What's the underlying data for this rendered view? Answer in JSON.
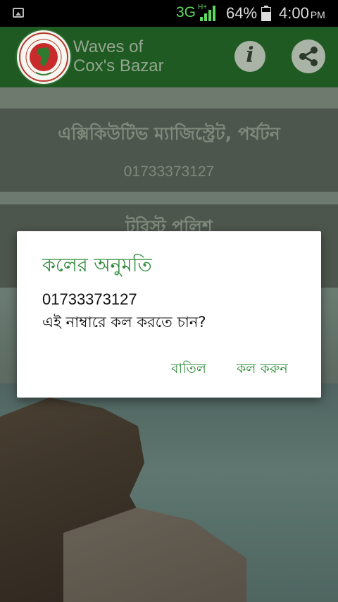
{
  "status_bar": {
    "network": "3G",
    "network_sup": "H+",
    "battery_percent": "64%",
    "time": "4:00",
    "ampm": "PM",
    "icons": [
      "image-icon",
      "signal-icon",
      "battery-icon"
    ]
  },
  "app_bar": {
    "title": "Waves of Cox's Bazar",
    "info_icon_label": "i",
    "background_color": "#1f5a22",
    "icons": [
      "logo-emblem",
      "info-icon",
      "share-icon"
    ]
  },
  "contacts": [
    {
      "title": "এক্সিকিউটিভ ম্যাজিস্ট্রেট, পর্যটন",
      "phone": "01733373127"
    },
    {
      "title": "টুরিস্ট পুলিশ",
      "phone": ""
    }
  ],
  "dialog": {
    "title": "কলের অনুমতি",
    "number": "01733373127",
    "question": "এই নাম্বারে কল করতে চান?",
    "cancel_label": "বাতিল",
    "call_label": "কল করুন",
    "accent_color": "#2e8b3a"
  }
}
